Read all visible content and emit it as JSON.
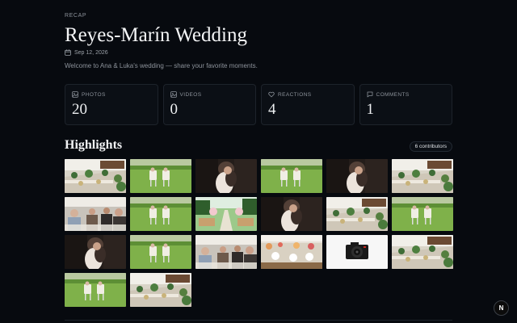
{
  "header": {
    "eyebrow": "RECAP",
    "title": "Reyes-Marín Wedding",
    "date": "Sep 12, 2026",
    "description": "Welcome to Ana & Luka's wedding — share your favorite moments."
  },
  "stats": [
    {
      "label": "PHOTOS",
      "value": "20",
      "icon": "image-icon"
    },
    {
      "label": "VIDEOS",
      "value": "0",
      "icon": "image-icon"
    },
    {
      "label": "REACTIONS",
      "value": "4",
      "icon": "heart-icon"
    },
    {
      "label": "COMMENTS",
      "value": "1",
      "icon": "message-icon"
    }
  ],
  "highlights": {
    "title": "Highlights",
    "contributors": "6 contributors",
    "photos": [
      {
        "kind": "table",
        "name": "photo-banquet-table"
      },
      {
        "kind": "chairs",
        "name": "photo-chairs-lawn"
      },
      {
        "kind": "couple",
        "name": "photo-couple-dark"
      },
      {
        "kind": "chairs",
        "name": "photo-chairs-lawn"
      },
      {
        "kind": "couple",
        "name": "photo-couple-dark"
      },
      {
        "kind": "table",
        "name": "photo-banquet-table"
      },
      {
        "kind": "guests",
        "name": "photo-guests-dining"
      },
      {
        "kind": "chairs",
        "name": "photo-chairs-lawn"
      },
      {
        "kind": "aisle",
        "name": "photo-ceremony-aisle"
      },
      {
        "kind": "couple",
        "name": "photo-couple-dark"
      },
      {
        "kind": "table",
        "name": "photo-banquet-table"
      },
      {
        "kind": "chairs",
        "name": "photo-chairs-lawn"
      },
      {
        "kind": "couple",
        "name": "photo-couple-dark"
      },
      {
        "kind": "chairs",
        "name": "photo-chairs-lawn"
      },
      {
        "kind": "guests",
        "name": "photo-guests-dining"
      },
      {
        "kind": "setting",
        "name": "photo-table-setting"
      },
      {
        "kind": "camera",
        "name": "photo-camera"
      },
      {
        "kind": "table",
        "name": "photo-banquet-table"
      },
      {
        "kind": "chairs",
        "name": "photo-chairs-lawn"
      },
      {
        "kind": "table",
        "name": "photo-banquet-table"
      }
    ]
  },
  "dev_badge": "N"
}
